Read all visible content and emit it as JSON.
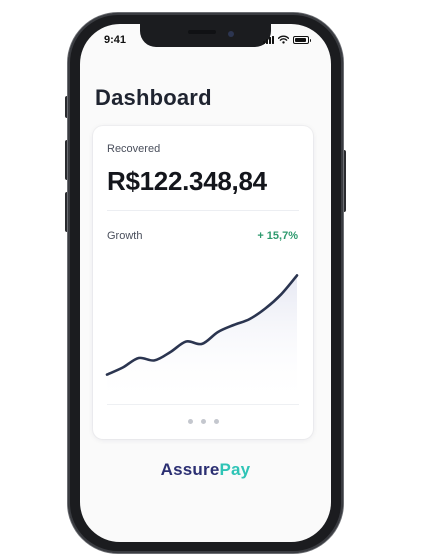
{
  "status_bar": {
    "time": "9:41"
  },
  "header": {
    "title": "Dashboard"
  },
  "card": {
    "recovered_label": "Recovered",
    "recovered_value": "R$122.348,84",
    "growth_label": "Growth",
    "growth_value": "+ 15,7%",
    "pager": {
      "pages": 3
    }
  },
  "chart_data": {
    "type": "area",
    "title": "",
    "xlabel": "",
    "ylabel": "",
    "x": [
      0,
      1,
      2,
      3,
      4,
      5,
      6,
      7,
      8,
      9,
      10,
      11,
      12
    ],
    "series": [
      {
        "values": [
          8,
          14,
          22,
          20,
          27,
          36,
          34,
          44,
          50,
          55,
          64,
          76,
          92
        ]
      }
    ],
    "ylim": [
      0,
      100
    ],
    "grid": false,
    "legend": "none"
  },
  "brand": {
    "part1": "Assure",
    "part2": "Pay"
  },
  "colors": {
    "line": "#2b3550",
    "fill_top": "#e6e8f3",
    "growth_positive": "#2e9a6e",
    "brand_primary": "#2b2f72",
    "brand_accent": "#2fc4b6"
  },
  "icons": {
    "signal": "cellular-signal-icon",
    "wifi": "wifi-icon",
    "battery": "battery-icon"
  }
}
